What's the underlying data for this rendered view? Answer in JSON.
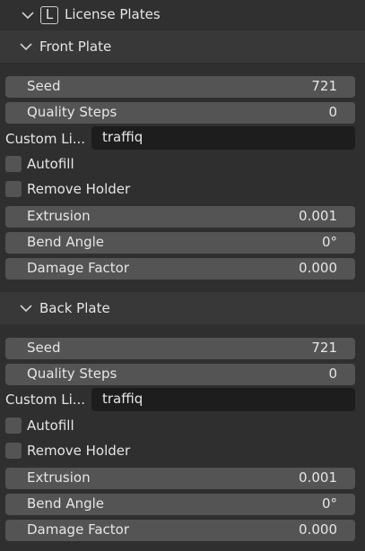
{
  "panel": {
    "title": "License Plates",
    "badge": "L"
  },
  "front": {
    "title": "Front Plate",
    "seed": {
      "label": "Seed",
      "value": "721"
    },
    "quality": {
      "label": "Quality Steps",
      "value": "0"
    },
    "custom": {
      "label": "Custom Li...",
      "value": "traffiq"
    },
    "autofill": {
      "label": "Autofill",
      "checked": false
    },
    "remove_holder": {
      "label": "Remove Holder",
      "checked": false
    },
    "extrusion": {
      "label": "Extrusion",
      "value": "0.001"
    },
    "bend": {
      "label": "Bend Angle",
      "value": "0°"
    },
    "damage": {
      "label": "Damage Factor",
      "value": "0.000"
    }
  },
  "back": {
    "title": "Back Plate",
    "seed": {
      "label": "Seed",
      "value": "721"
    },
    "quality": {
      "label": "Quality Steps",
      "value": "0"
    },
    "custom": {
      "label": "Custom Li...",
      "value": "traffiq"
    },
    "autofill": {
      "label": "Autofill",
      "checked": false
    },
    "remove_holder": {
      "label": "Remove Holder",
      "checked": false
    },
    "extrusion": {
      "label": "Extrusion",
      "value": "0.001"
    },
    "bend": {
      "label": "Bend Angle",
      "value": "0°"
    },
    "damage": {
      "label": "Damage Factor",
      "value": "0.000"
    }
  }
}
